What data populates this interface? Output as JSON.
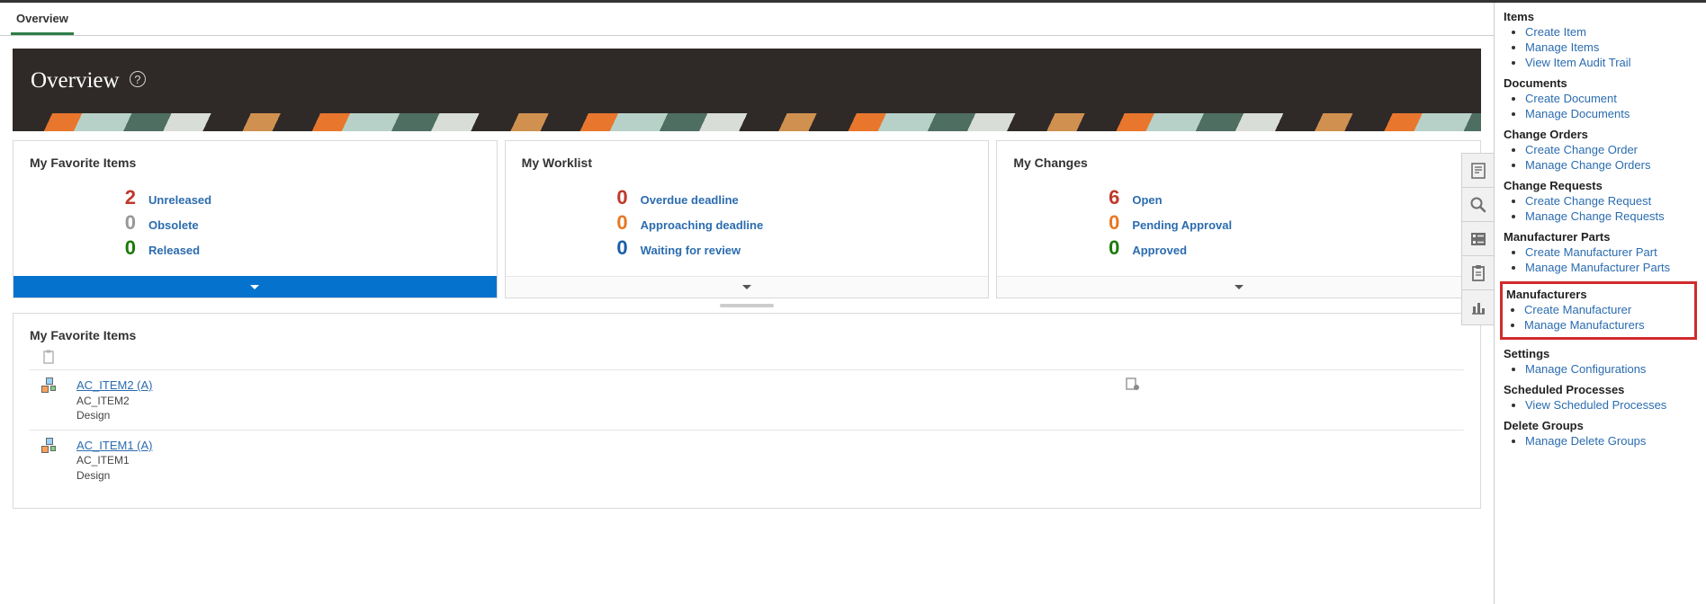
{
  "tabs": {
    "overview": "Overview"
  },
  "hero": {
    "title": "Overview",
    "help_glyph": "?"
  },
  "cards": {
    "fav": {
      "title": "My Favorite Items",
      "rows": [
        {
          "n": "2",
          "label": "Unreleased",
          "ncls": "stat-red",
          "lcls": "link-blue"
        },
        {
          "n": "0",
          "label": "Obsolete",
          "ncls": "stat-grey",
          "lcls": "link-blue"
        },
        {
          "n": "0",
          "label": "Released",
          "ncls": "stat-green",
          "lcls": "link-blue"
        }
      ]
    },
    "worklist": {
      "title": "My Worklist",
      "rows": [
        {
          "n": "0",
          "label": "Overdue deadline",
          "ncls": "stat-red",
          "lcls": "link-blue"
        },
        {
          "n": "0",
          "label": "Approaching deadline",
          "ncls": "stat-orange",
          "lcls": "link-blue"
        },
        {
          "n": "0",
          "label": "Waiting for review",
          "ncls": "stat-blue",
          "lcls": "link-blue"
        }
      ]
    },
    "changes": {
      "title": "My Changes",
      "rows": [
        {
          "n": "6",
          "label": "Open",
          "ncls": "stat-red",
          "lcls": "link-blue"
        },
        {
          "n": "0",
          "label": "Pending Approval",
          "ncls": "stat-orange",
          "lcls": "link-blue"
        },
        {
          "n": "0",
          "label": "Approved",
          "ncls": "stat-green",
          "lcls": "link-blue"
        }
      ]
    }
  },
  "detail": {
    "title": "My Favorite Items",
    "items": [
      {
        "link": "AC_ITEM2 (A)",
        "code": "AC_ITEM2",
        "phase": "Design"
      },
      {
        "link": "AC_ITEM1 (A)",
        "code": "AC_ITEM1",
        "phase": "Design"
      }
    ]
  },
  "sidebar": [
    {
      "head": "Items",
      "links": [
        "Create Item",
        "Manage Items",
        "View Item Audit Trail"
      ]
    },
    {
      "head": "Documents",
      "links": [
        "Create Document",
        "Manage Documents"
      ]
    },
    {
      "head": "Change Orders",
      "links": [
        "Create Change Order",
        "Manage Change Orders"
      ]
    },
    {
      "head": "Change Requests",
      "links": [
        "Create Change Request",
        "Manage Change Requests"
      ]
    },
    {
      "head": "Manufacturer Parts",
      "links": [
        "Create Manufacturer Part",
        "Manage Manufacturer Parts"
      ]
    },
    {
      "head": "Manufacturers",
      "links": [
        "Create Manufacturer",
        "Manage Manufacturers"
      ],
      "highlight": true
    },
    {
      "head": "Settings",
      "links": [
        "Manage Configurations"
      ]
    },
    {
      "head": "Scheduled Processes",
      "links": [
        "View Scheduled Processes"
      ]
    },
    {
      "head": "Delete Groups",
      "links": [
        "Manage Delete Groups"
      ]
    }
  ],
  "dock_icons": [
    "page-icon",
    "search-icon",
    "checklist-icon",
    "clipboard-icon",
    "chart-icon"
  ]
}
